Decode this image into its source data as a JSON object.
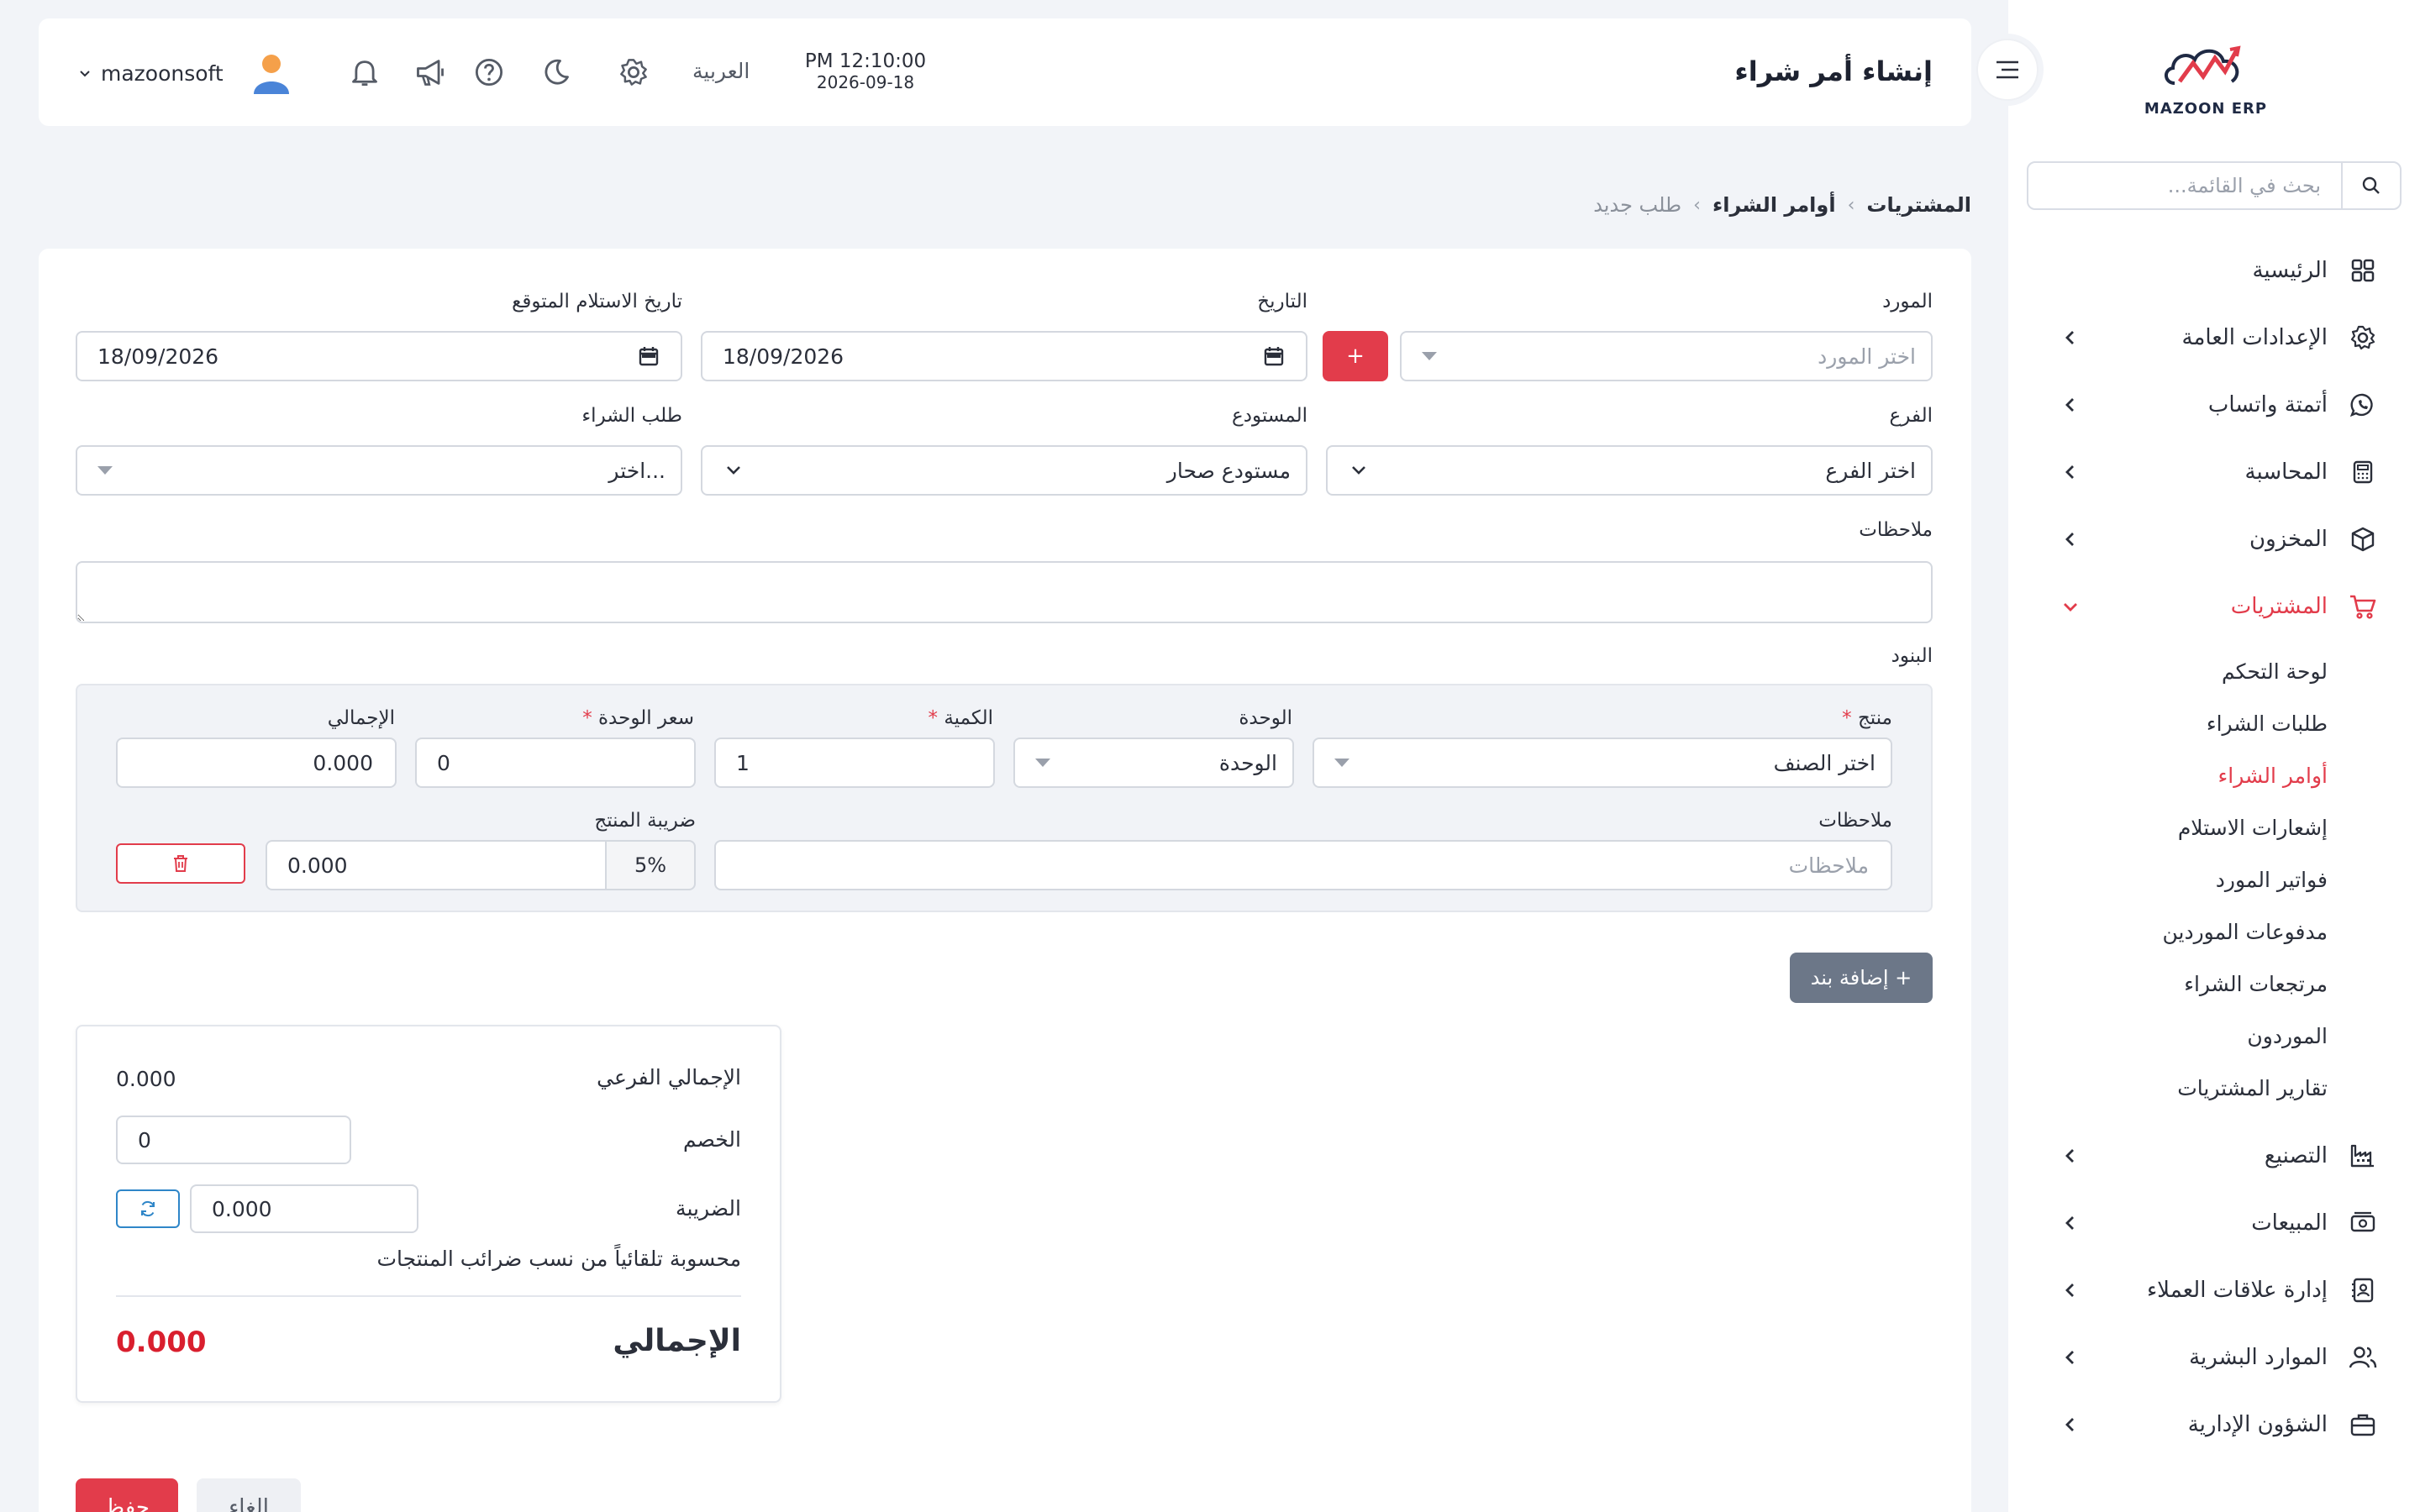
{
  "app": {
    "logo_text": "MAZOON ERP"
  },
  "header": {
    "title": "إنشاء أمر شراء",
    "time": "PM 12:10:00",
    "date": "2026-09-18",
    "language": "العربية",
    "username": "mazoonsoft"
  },
  "sidebar": {
    "search_placeholder": "بحث في القائمة...",
    "items": [
      {
        "label": "الرئيسية",
        "icon": "grid-icon"
      },
      {
        "label": "الإعدادات العامة",
        "icon": "gear-icon"
      },
      {
        "label": "أتمتة واتساب",
        "icon": "whatsapp-icon"
      },
      {
        "label": "المحاسبة",
        "icon": "calculator-icon"
      },
      {
        "label": "المخزون",
        "icon": "box-icon"
      },
      {
        "label": "المشتريات",
        "icon": "cart-icon"
      },
      {
        "label": "التصنيع",
        "icon": "factory-icon"
      },
      {
        "label": "المبيعات",
        "icon": "cash-icon"
      },
      {
        "label": "إدارة علاقات العملاء",
        "icon": "contacts-icon"
      },
      {
        "label": "الموارد البشرية",
        "icon": "users-icon"
      },
      {
        "label": "الشؤون الإدارية",
        "icon": "briefcase-icon"
      }
    ],
    "purchases_sub": [
      "لوحة التحكم",
      "طلبات الشراء",
      "أوامر الشراء",
      "إشعارات الاستلام",
      "فواتير المورد",
      "مدفوعات الموردين",
      "مرتجعات الشراء",
      "الموردون",
      "تقارير المشتريات"
    ]
  },
  "breadcrumb": [
    "المشتريات",
    "أوامر الشراء",
    "طلب جديد"
  ],
  "form": {
    "supplier_label": "المورد",
    "supplier_placeholder": "اختر المورد",
    "add_label": "+",
    "date_label": "التاريخ",
    "date_value": "18/09/2026",
    "expected_label": "تاريخ الاستلام المتوقع",
    "expected_value": "18/09/2026",
    "branch_label": "الفرع",
    "branch_placeholder": "اختر الفرع",
    "warehouse_label": "المستودع",
    "warehouse_value": "مستودع صحار",
    "request_label": "طلب الشراء",
    "request_placeholder": "اختر...",
    "notes_label": "ملاحظات",
    "items_label": "البنود"
  },
  "item_row": {
    "product_label": "منتج",
    "product_placeholder": "اختر الصنف",
    "unit_label": "الوحدة",
    "unit_value": "الوحدة",
    "qty_label": "الكمية",
    "qty_value": "1",
    "price_label": "سعر الوحدة",
    "price_value": "0",
    "total_label": "الإجمالي",
    "total_value": "0.000",
    "notes_label": "ملاحظات",
    "notes_placeholder": "ملاحظات",
    "tax_label": "ضريبة المنتج",
    "tax_pct": "5%",
    "tax_value": "0.000",
    "required_mark": "*"
  },
  "add_line_label": "+ إضافة بند",
  "summary": {
    "subtotal_label": "الإجمالي الفرعي",
    "subtotal_value": "0.000",
    "discount_label": "الخصم",
    "discount_value": "0",
    "tax_label": "الضريبة",
    "tax_value": "0.000",
    "tax_note": "محسوبة تلقائياً من نسب ضرائب المنتجات",
    "total_label": "الإجمالي",
    "total_value": "0.000"
  },
  "actions": {
    "save": "حفظ",
    "cancel": "الغاء"
  },
  "colors": {
    "accent": "#e23c4b",
    "muted_button": "#6c7788",
    "total_red": "#d91f2e",
    "refresh_blue": "#2f86c8"
  }
}
